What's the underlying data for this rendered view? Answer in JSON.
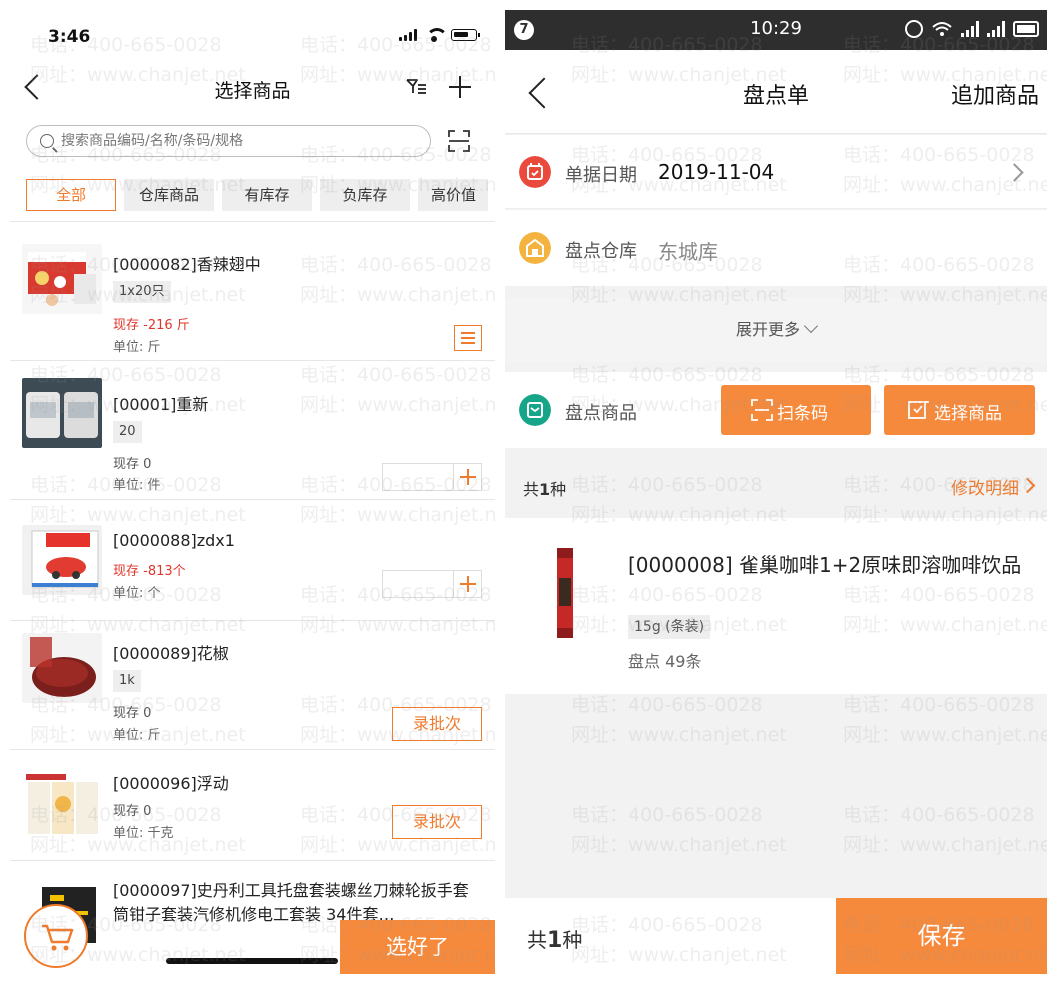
{
  "left": {
    "status": {
      "time": "3:46"
    },
    "nav": {
      "title": "选择商品"
    },
    "search": {
      "placeholder": "搜索商品编码/名称/条码/规格"
    },
    "chips": [
      "全部",
      "仓库商品",
      "有库存",
      "负库存",
      "高价值"
    ],
    "items": [
      {
        "name": "[0000082]香辣翅中",
        "spec": "1x20只",
        "stock": "现存 -216 斤",
        "unit": "单位: 斤",
        "action": "menu"
      },
      {
        "name": "[00001]重新",
        "spec": "20",
        "stock": "现存 0",
        "unit": "单位: 件",
        "action": "qty"
      },
      {
        "name": "[0000088]zdx1",
        "spec": "",
        "stock": "现存 -813个",
        "unit": "单位: 个",
        "action": "qty"
      },
      {
        "name": "[0000089]花椒",
        "spec": "1k",
        "stock": "现存 0",
        "unit": "单位: 斤",
        "action": "batch"
      },
      {
        "name": "[0000096]浮动",
        "spec": "",
        "stock": "现存 0",
        "unit": "单位: 千克",
        "action": "batch"
      },
      {
        "name": "[0000097]史丹利工具托盘套装螺丝刀棘轮扳手套筒钳子套装汽修机修电工套装 34件套…",
        "spec": "",
        "stock": "",
        "unit": "",
        "action": "none"
      }
    ],
    "batch_label": "录批次",
    "done_label": "选好了"
  },
  "right": {
    "status": {
      "badge": "7",
      "time": "10:29"
    },
    "nav": {
      "title": "盘点单",
      "action": "追加商品"
    },
    "date_row": {
      "label": "单据日期",
      "value": "2019-11-04"
    },
    "warehouse_row": {
      "label": "盘点仓库",
      "value": "东城库"
    },
    "expand_label": "展开更多",
    "goods_row": {
      "label": "盘点商品",
      "scan_label": "扫条码",
      "select_label": "选择商品"
    },
    "summary": {
      "prefix": "共",
      "count": "1",
      "suffix": "种",
      "edit_label": "修改明细"
    },
    "product": {
      "name": "[0000008] 雀巢咖啡1+2原味即溶咖啡饮品",
      "spec": "15g (条装)",
      "qty": "盘点 49条"
    },
    "footer": {
      "prefix": "共",
      "count": "1",
      "suffix": "种",
      "save_label": "保存"
    }
  },
  "watermark": {
    "phone": "电话：400-665-0028",
    "site": "网址：www.chanjet.net"
  },
  "colors": {
    "accent": "#f68a3c",
    "negative": "#e0352b",
    "date_icon": "#ea4a3c",
    "warehouse_icon": "#f4b23e",
    "goods_icon": "#17a589"
  }
}
